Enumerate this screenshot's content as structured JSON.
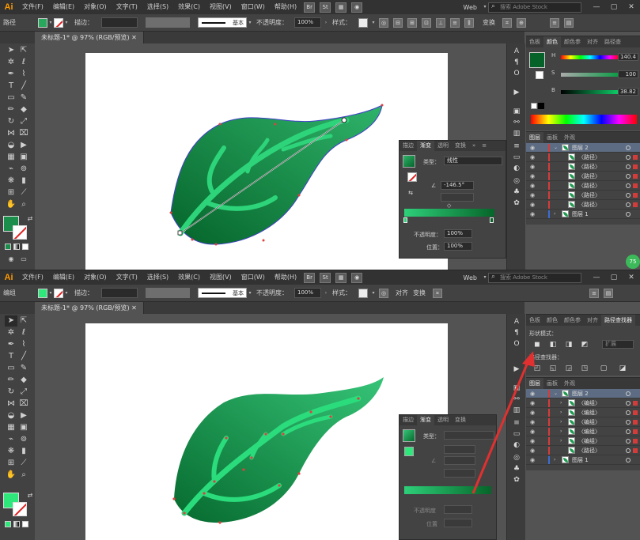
{
  "app": {
    "logo": "Ai",
    "menu": [
      "文件(F)",
      "编辑(E)",
      "对象(O)",
      "文字(T)",
      "选择(S)",
      "效果(C)",
      "视图(V)",
      "窗口(W)",
      "帮助(H)"
    ],
    "bridge_btns": [
      "Br",
      "St"
    ],
    "workspace": "Web",
    "stock_placeholder": "搜索 Adobe Stock",
    "win_buttons": [
      "—",
      "▢",
      "✕"
    ]
  },
  "colors": {
    "accent_green": "#1e9a52",
    "light_green": "#2bdc7c",
    "red": "#e02020"
  },
  "shot1": {
    "control": {
      "selection_label": "路径",
      "fill_color": "#28a85c",
      "stroke_label": "描边：",
      "style_name": "基本",
      "opacity_label": "不透明度：",
      "opacity_value": "100%",
      "style_label": "样式：",
      "right_labels": [
        "变换"
      ]
    },
    "doc_tab": "未标题-1* @ 97% (RGB/预览)",
    "color_panel": {
      "tabs": [
        "色板",
        "颜色",
        "颜色参",
        "对齐",
        "路径查"
      ],
      "active_tab": "颜色",
      "channels": [
        {
          "label": "H",
          "value": "140.4"
        },
        {
          "label": "S",
          "value": "100"
        },
        {
          "label": "B",
          "value": "38.82"
        }
      ],
      "swatch_color": "#05632a"
    },
    "layers_panel": {
      "tabs": [
        "图层",
        "画板",
        "外观"
      ],
      "rows": [
        {
          "name": "图层 2",
          "level": 0,
          "selected": true,
          "bar": "red",
          "toggle": "⌄"
        },
        {
          "name": "〈路径〉",
          "level": 1,
          "selected": false,
          "bar": "red",
          "toggle": ""
        },
        {
          "name": "〈路径〉",
          "level": 1,
          "selected": false,
          "bar": "red",
          "toggle": ""
        },
        {
          "name": "〈路径〉",
          "level": 1,
          "selected": false,
          "bar": "red",
          "toggle": ""
        },
        {
          "name": "〈路径〉",
          "level": 1,
          "selected": false,
          "bar": "red",
          "toggle": ""
        },
        {
          "name": "〈路径〉",
          "level": 1,
          "selected": false,
          "bar": "red",
          "toggle": ""
        },
        {
          "name": "〈路径〉",
          "level": 1,
          "selected": false,
          "bar": "red",
          "toggle": ""
        },
        {
          "name": "图层 1",
          "level": 0,
          "selected": false,
          "bar": "blue",
          "toggle": "›"
        }
      ]
    },
    "gradient_panel": {
      "tabs": [
        "描边",
        "渐变",
        "透明",
        "变换"
      ],
      "active_tab": "渐变",
      "type_label": "类型：",
      "type_value": "线性",
      "angle_value": "-146.5°",
      "opacity_label": "不透明度：",
      "opacity_value": "100%",
      "position_label": "位置：",
      "position_value": "100%"
    },
    "badge": "75"
  },
  "shot2": {
    "control": {
      "selection_label": "编组",
      "fill_color": "#2ee87c",
      "stroke_label": "描边：",
      "style_name": "基本",
      "opacity_label": "不透明度：",
      "opacity_value": "100%",
      "style_label": "样式：",
      "right_labels": [
        "对齐",
        "变换"
      ]
    },
    "doc_tab": "未标题-1* @ 97% (RGB/预览)",
    "pathfinder_panel": {
      "tabs": [
        "色板",
        "颜色",
        "颜色参",
        "对齐",
        "路径查找器"
      ],
      "active_tab": "路径查找器",
      "shape_modes_label": "形状模式：",
      "pathfinders_label": "路径查找器：",
      "expand_label": "扩展"
    },
    "layers_panel": {
      "tabs": [
        "图层",
        "画板",
        "外观"
      ],
      "rows": [
        {
          "name": "图层 2",
          "level": 0,
          "selected": true,
          "bar": "red",
          "toggle": "⌄"
        },
        {
          "name": "〈编组〉",
          "level": 1,
          "selected": false,
          "bar": "red",
          "toggle": "›"
        },
        {
          "name": "〈编组〉",
          "level": 1,
          "selected": false,
          "bar": "red",
          "toggle": "›"
        },
        {
          "name": "〈编组〉",
          "level": 1,
          "selected": false,
          "bar": "red",
          "toggle": "›"
        },
        {
          "name": "〈编组〉",
          "level": 1,
          "selected": false,
          "bar": "red",
          "toggle": "›"
        },
        {
          "name": "〈编组〉",
          "level": 1,
          "selected": false,
          "bar": "red",
          "toggle": "›"
        },
        {
          "name": "〈路径〉",
          "level": 1,
          "selected": false,
          "bar": "red",
          "toggle": ""
        },
        {
          "name": "图层 1",
          "level": 0,
          "selected": false,
          "bar": "blue",
          "toggle": "›"
        }
      ]
    },
    "gradient_panel": {
      "tabs": [
        "描边",
        "渐变",
        "透明",
        "变换"
      ],
      "active_tab": "渐变",
      "type_label": "类型：",
      "opacity_label": "不透明度",
      "position_label": "位置"
    }
  }
}
